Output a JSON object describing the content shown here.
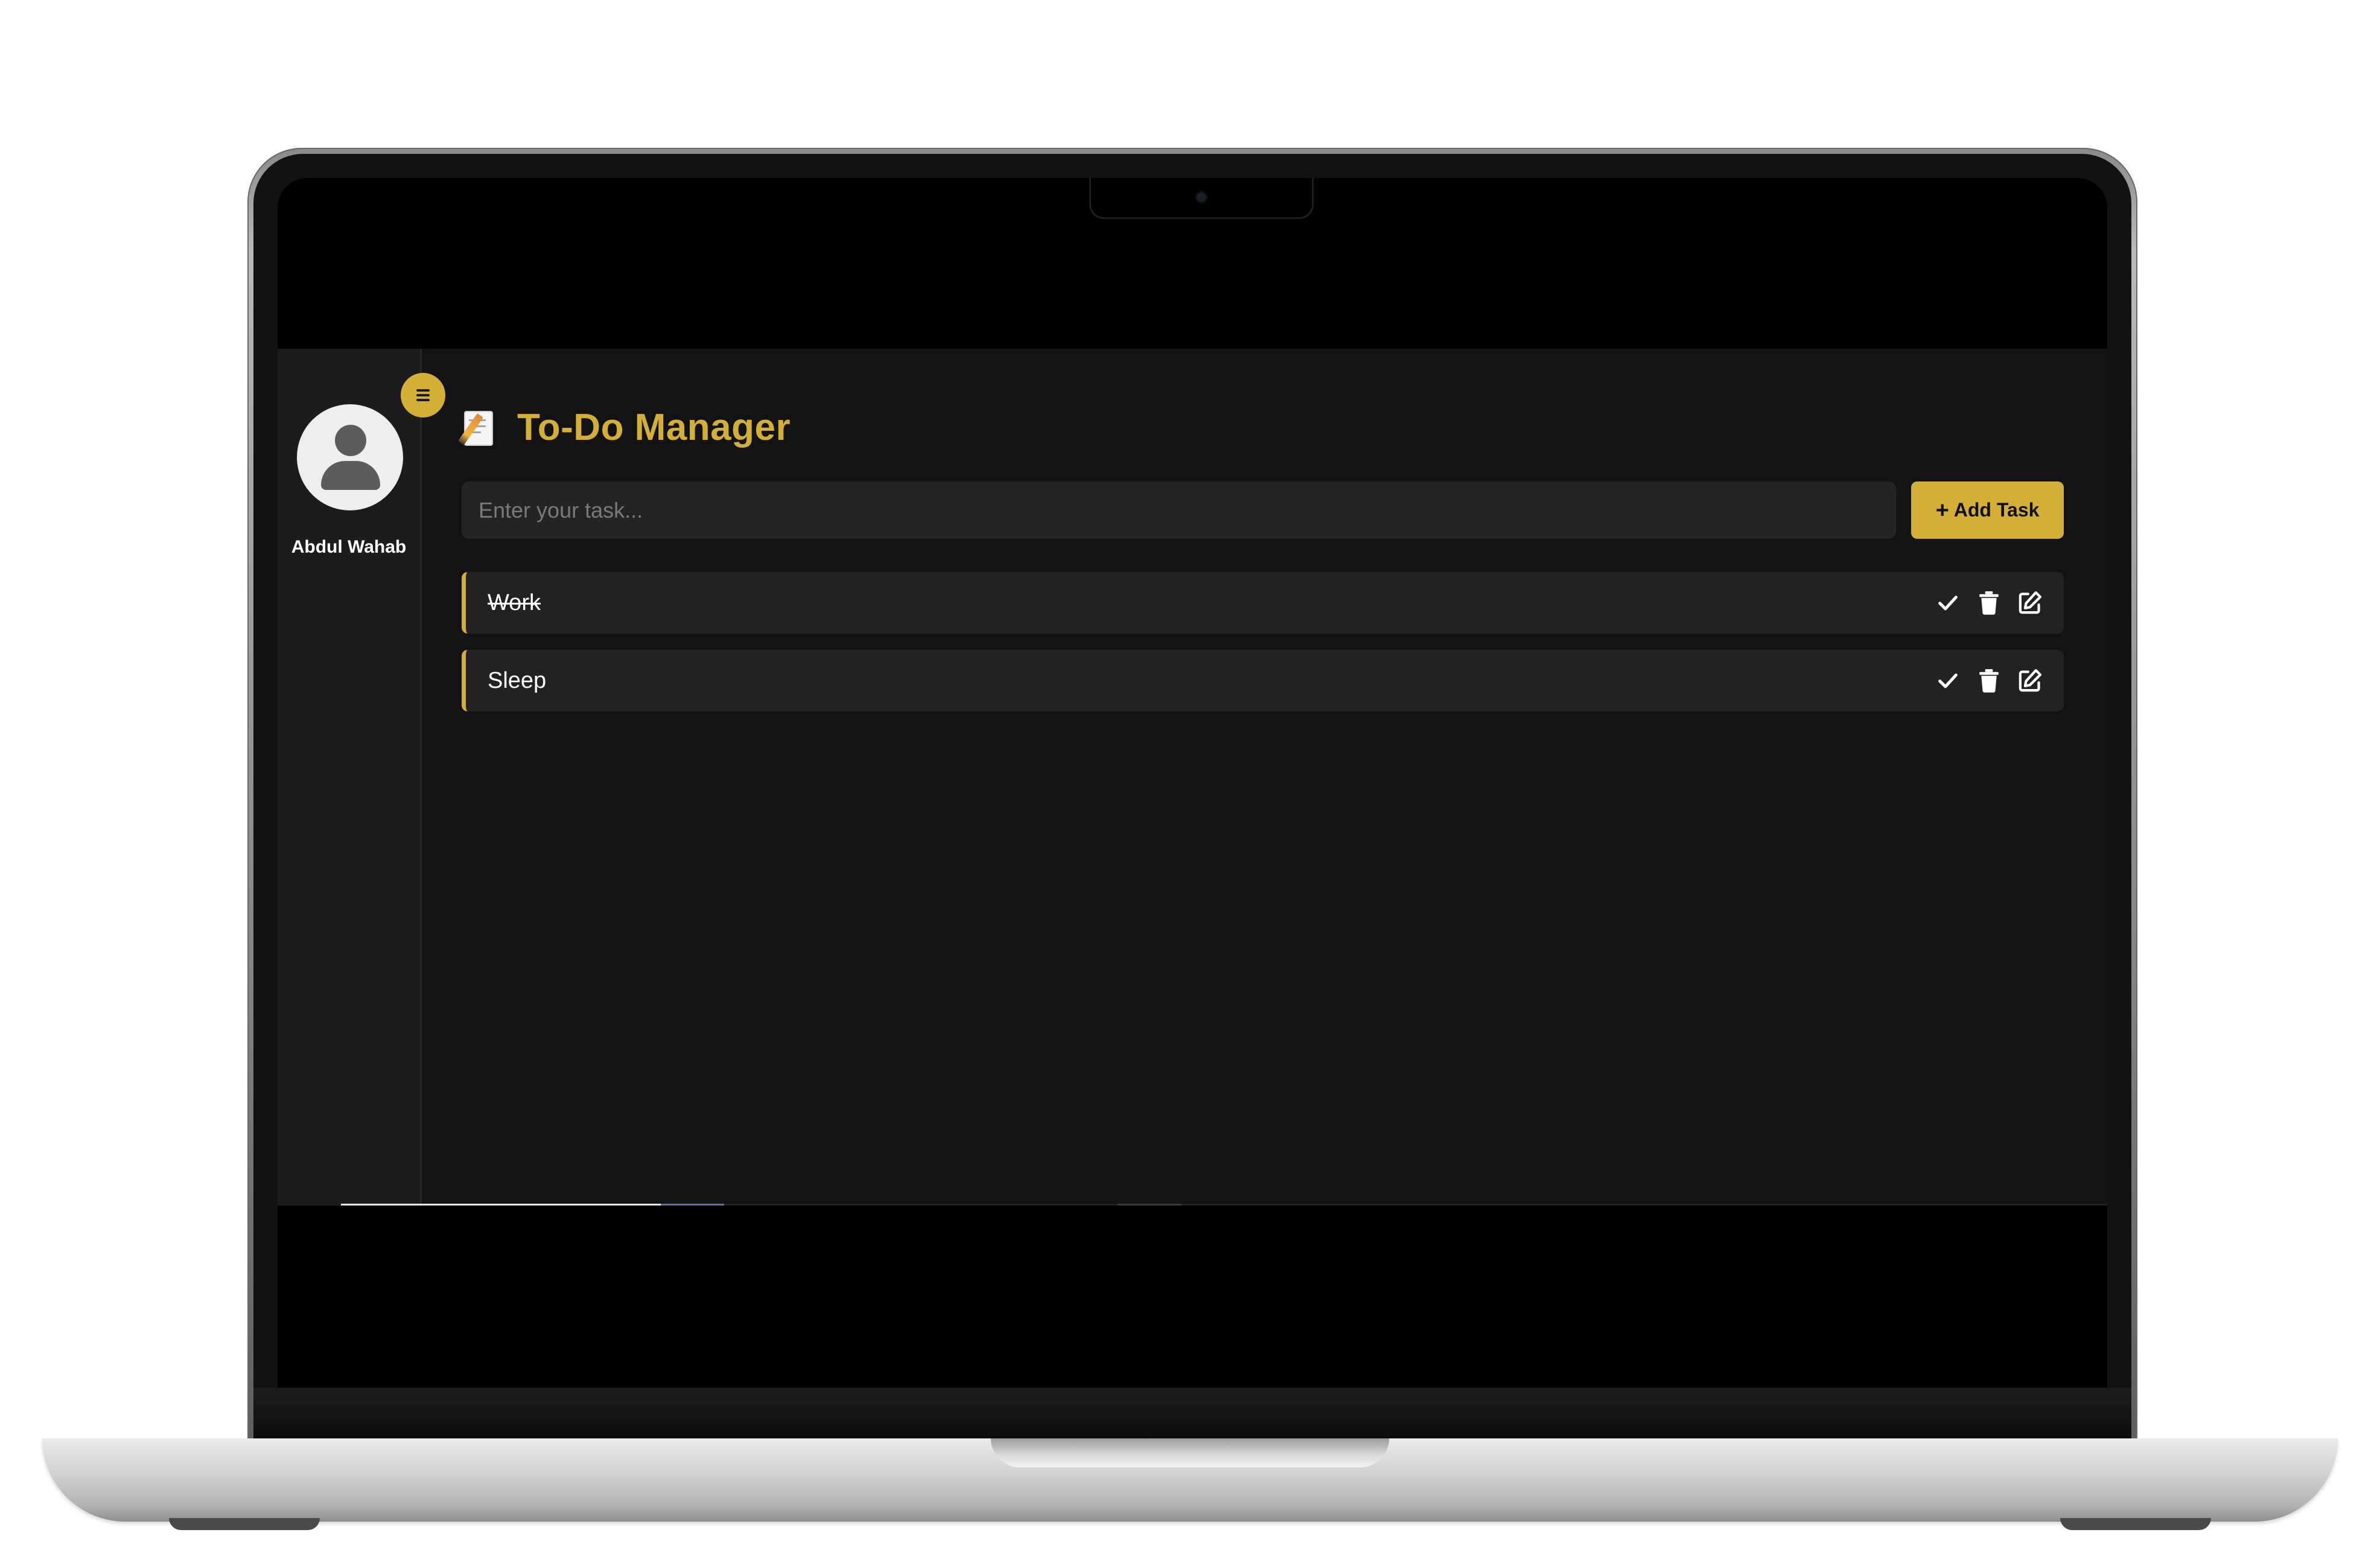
{
  "sidebar": {
    "user_name": "Abdul Wahab",
    "avatar_icon": "user-avatar-icon",
    "menu_icon": "hamburger-menu-icon"
  },
  "header": {
    "title_icon": "memo-icon",
    "title": "To-Do Manager"
  },
  "task_form": {
    "input_value": "",
    "input_placeholder": "Enter your task...",
    "add_button_label": "Add Task",
    "add_button_icon": "plus-icon"
  },
  "tasks": [
    {
      "text": "Work",
      "completed": true
    },
    {
      "text": "Sleep",
      "completed": false
    }
  ],
  "task_action_icons": [
    "check-icon",
    "trash-icon",
    "edit-icon"
  ],
  "colors": {
    "accent": "#d4af37",
    "app_background": "#131313",
    "sidebar_background": "#1c1c1c",
    "card_background": "#222222",
    "input_background": "#242424",
    "text_primary": "#ffffff"
  }
}
